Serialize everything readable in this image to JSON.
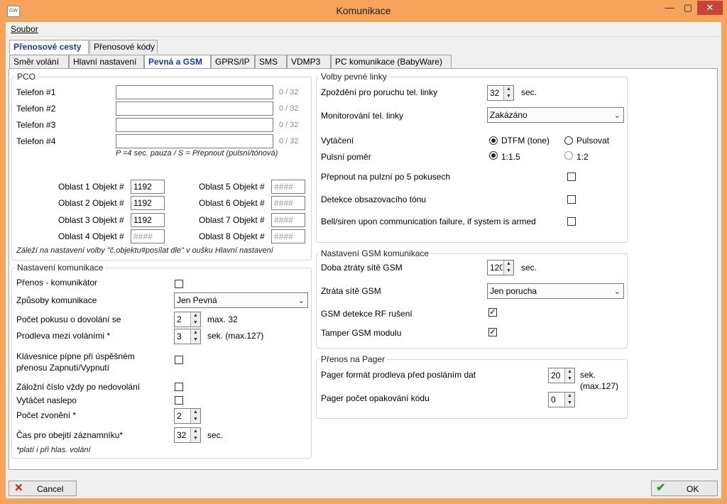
{
  "window": {
    "title": "Komunikace",
    "app_icon": "GW",
    "minimize": "—",
    "maximize": "▢",
    "close": "✕"
  },
  "menu": {
    "file": "Soubor"
  },
  "tabs_top": [
    "Přenosové cesty",
    "Přenosové kódy"
  ],
  "tabs_second": [
    "Směr volání",
    "Hlavní nastavení",
    "Pevná a GSM",
    "GPRS/IP",
    "SMS",
    "VDMP3",
    "PC komunikace (BabyWare)"
  ],
  "pco": {
    "legend": "PCO",
    "phones": [
      {
        "label": "Telefon #1",
        "value": "",
        "count": "0 / 32"
      },
      {
        "label": "Telefon #2",
        "value": "",
        "count": "0 / 32"
      },
      {
        "label": "Telefon #3",
        "value": "",
        "count": "0 / 32"
      },
      {
        "label": "Telefon #4",
        "value": "",
        "count": "0 / 32"
      }
    ],
    "hint": "P =4 sec. pauza / S = Přepnout (pulsní/tónová)",
    "areas": [
      {
        "label": "Oblast 1 Objekt #",
        "value": "1192"
      },
      {
        "label": "Oblast 2 Objekt #",
        "value": "1192"
      },
      {
        "label": "Oblast 3 Objekt #",
        "value": "1192"
      },
      {
        "label": "Oblast 4 Objekt #",
        "value": "####"
      },
      {
        "label": "Oblast 5 Objekt #",
        "value": "####"
      },
      {
        "label": "Oblast 6 Objekt #",
        "value": "####"
      },
      {
        "label": "Oblast 7 Objekt #",
        "value": "####"
      },
      {
        "label": "Oblast 8 Objekt #",
        "value": "####"
      }
    ],
    "note": "Záleží na nastavení volby \"č.objektu#posílat dle\" v oušku Hlavní nastavení"
  },
  "komunikace": {
    "legend": "Nastavení komunikace",
    "prenos_label": "Přenos - komunikátor",
    "prenos_checked": false,
    "zpusoby_label": "Způsoby komunikace",
    "zpusoby_value": "Jen Pevná",
    "pokusy_label": "Počet pokusu o dovolání se",
    "pokusy_value": "2",
    "pokusy_suffix": "max. 32",
    "prodleva_label": "Prodleva mezi voláními *",
    "prodleva_value": "3",
    "prodleva_suffix": "sek. (max.127)",
    "klavesnice_label_1": "Klávesnice pípne při úspěšném",
    "klavesnice_label_2": "přenosu Zapnutí/Vypnutí",
    "klavesnice_checked": false,
    "zalozni_label": "Záložní číslo vždy po nedovolání",
    "zalozni_checked": false,
    "vytacet_label": "Vytáčet naslepo",
    "vytacet_checked": false,
    "zvoneni_label": "Počet zvonění *",
    "zvoneni_value": "2",
    "cas_label": "Čas pro obejití záznamníku*",
    "cas_value": "32",
    "cas_suffix": "sec.",
    "note": "*platí i při hlas. volání"
  },
  "pevna": {
    "legend": "Volby pevné linky",
    "zpozdeni_label": "Zpoždění pro poruchu tel. linky",
    "zpozdeni_value": "32",
    "zpozdeni_suffix": "sec.",
    "monitor_label": "Monitorování tel. linky",
    "monitor_value": "Zakázáno",
    "vytaceni_label": "Vytáčení",
    "vytaceni_opt1": "DTFM (tone)",
    "vytaceni_opt2": "Pulsovat",
    "pomer_label": "Pulsní poměr",
    "pomer_opt1": "1:1.5",
    "pomer_opt2": "1:2",
    "prepnout_label": "Přepnout na pulzní po 5 pokusech",
    "prepnout_checked": false,
    "detekce_label": "Detekce obsazovacího tónu",
    "detekce_checked": false,
    "bell_label": "Bell/siren upon communication failure, if system is armed",
    "bell_checked": false
  },
  "gsm": {
    "legend": "Nastavení GSM komunikace",
    "doba_label": "Doba ztráty sítě GSM",
    "doba_value": "120",
    "doba_suffix": "sec.",
    "ztrata_label": "Ztráta sítě GSM",
    "ztrata_value": "Jen porucha",
    "rf_label": "GSM detekce RF rušení",
    "rf_checked": true,
    "tamper_label": "Tamper GSM modulu",
    "tamper_checked": true
  },
  "pager": {
    "legend": "Přenos na Pager",
    "format_label": "Pager formát prodleva před posláním dat",
    "format_value": "20",
    "format_suffix_1": "sek.",
    "format_suffix_2": "(max.127)",
    "opak_label": "Pager počet opakování kódu",
    "opak_value": "0"
  },
  "footer": {
    "cancel": "Cancel",
    "ok": "OK"
  }
}
